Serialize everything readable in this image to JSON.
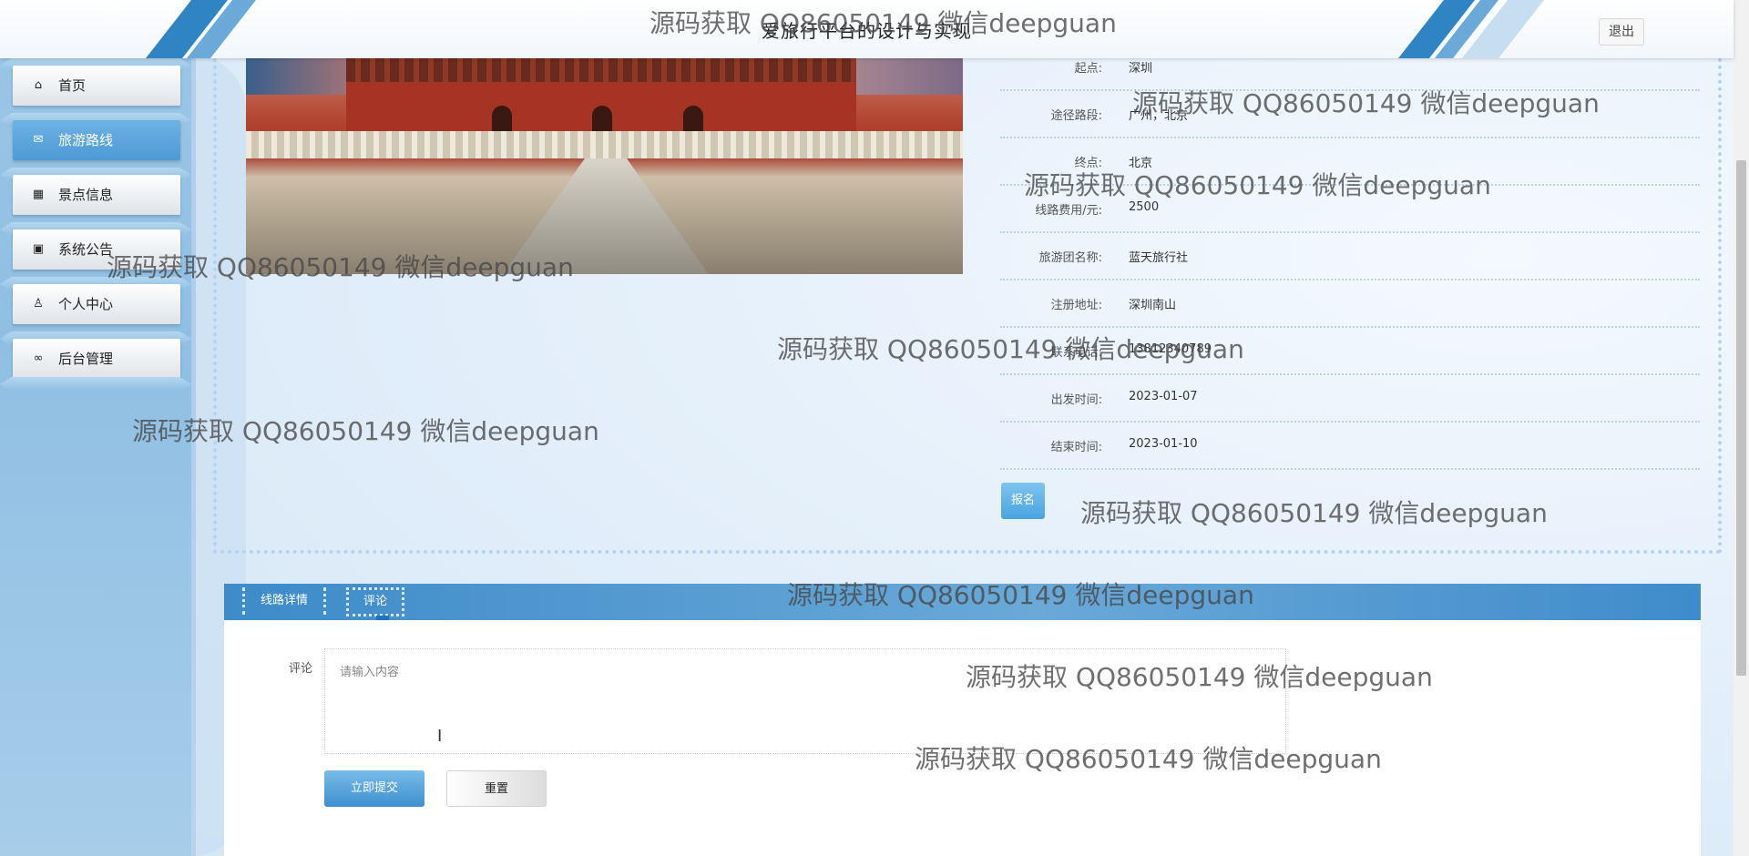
{
  "header": {
    "title": "爱旅行平台的设计与实现",
    "logout_label": "退出"
  },
  "sidebar": {
    "items": [
      {
        "label": "首页",
        "icon": "home-icon",
        "active": false
      },
      {
        "label": "旅游路线",
        "icon": "mail-icon",
        "active": true
      },
      {
        "label": "景点信息",
        "icon": "grid-icon",
        "active": false
      },
      {
        "label": "系统公告",
        "icon": "gift-icon",
        "active": false
      },
      {
        "label": "个人中心",
        "icon": "user-icon",
        "active": false
      },
      {
        "label": "后台管理",
        "icon": "link-icon",
        "active": false
      }
    ]
  },
  "detail": {
    "fields": [
      {
        "label": "起点:",
        "value": "深圳"
      },
      {
        "label": "途径路段:",
        "value": "广州，北京"
      },
      {
        "label": "终点:",
        "value": "北京"
      },
      {
        "label": "线路费用/元:",
        "value": "2500"
      },
      {
        "label": "旅游团名称:",
        "value": "蓝天旅行社"
      },
      {
        "label": "注册地址:",
        "value": "深圳南山"
      },
      {
        "label": "联系电话:",
        "value": "13812340789"
      },
      {
        "label": "出发时间:",
        "value": "2023-01-07"
      },
      {
        "label": "结束时间:",
        "value": "2023-01-10"
      }
    ],
    "signup_label": "报名"
  },
  "tabs": {
    "items": [
      "线路详情",
      "评论"
    ],
    "active": "评论"
  },
  "comment_form": {
    "label": "评论",
    "placeholder": "请输入内容",
    "submit_label": "立即提交",
    "reset_label": "重置"
  },
  "watermark_text": "源码获取 QQ86050149 微信deepguan"
}
